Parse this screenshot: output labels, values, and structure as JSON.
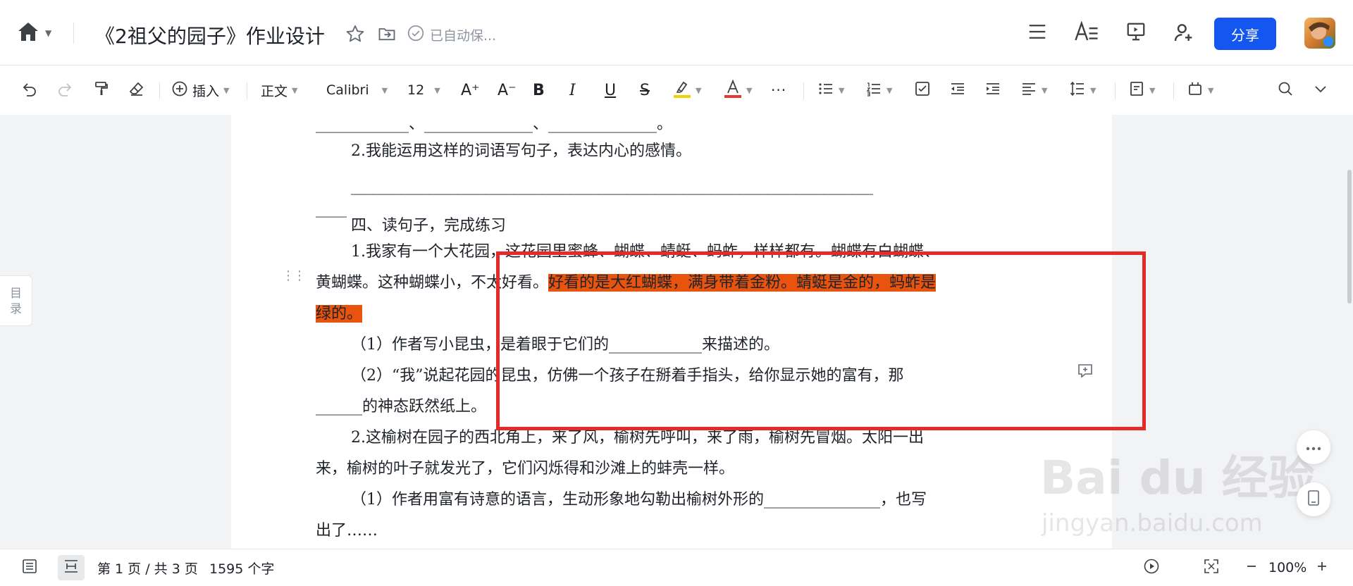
{
  "header": {
    "title": "《2祖父的园子》作业设计",
    "autosave_status": "已自动保...",
    "share_label": "分享"
  },
  "toolbar": {
    "insert_label": "插入",
    "style_label": "正文",
    "font_label": "Calibri",
    "size_label": "12",
    "more_label": "···",
    "highlight_color": "#f5d000",
    "font_color": "#e53935"
  },
  "sidebar": {
    "toc_label_1": "目",
    "toc_label_2": "录"
  },
  "document": {
    "lines": [
      "____________、______________、______________。",
      "2.我能运用这样的词语写句子，表达内心的感情。",
      "__________________________________________________________________________",
      "____",
      "四、读句子，完成练习",
      "1.我家有一个大花园，这花园里蜜蜂、蝴蝶、蜻蜓、蚂蚱，样样都有。蝴蝶有白蝴蝶、",
      "黄蝴蝶。这种蝴蝶小，不太好看。",
      "好看的是大红蝴蝶，满身带着金粉。蜻蜓是金的，蚂蚱是",
      "绿的。",
      "（1）作者写小昆虫，是着眼于它们的____________来描述的。",
      "（2）“我”说起花园的昆虫，仿佛一个孩子在掰着手指头，给你显示她的富有，那",
      "______的神态跃然纸上。",
      "2.这榆树在园子的西北角上，来了风，榆树先呼叫，来了雨，榆树先冒烟。太阳一出",
      "来，榆树的叶子就发光了，它们闪烁得和沙滩上的蚌壳一样。",
      "（1）作者用富有诗意的语言，生动形象地勾勒出榆树外形的_______________，也写",
      "出了……"
    ],
    "highlight_color": "#e8540e",
    "annotation_color": "#e52a2a"
  },
  "watermark": {
    "line1": "Bai du 经验",
    "line2": "jingyan.baidu.com"
  },
  "status": {
    "page_info": "第 1 页 / 共 3 页",
    "word_count": "1595 个字",
    "zoom": "100%"
  },
  "icons": [
    "home-icon",
    "star-icon",
    "move-icon",
    "cloud-check-icon",
    "menu-icon",
    "text-format-icon",
    "present-icon",
    "add-user-icon",
    "undo-icon",
    "redo-icon",
    "format-painter-icon",
    "eraser-icon",
    "plus-circle-icon",
    "bold-icon",
    "italic-icon",
    "underline-icon",
    "strikethrough-icon",
    "highlight-icon",
    "font-color-icon",
    "bullet-list-icon",
    "numbered-list-icon",
    "checkbox-icon",
    "outdent-icon",
    "indent-icon",
    "align-icon",
    "line-spacing-icon",
    "page-setup-icon",
    "plugin-icon",
    "search-icon",
    "chevron-down-icon",
    "comment-add-icon",
    "more-icon",
    "mobile-icon",
    "outline-icon",
    "page-view-icon",
    "play-icon",
    "fullscreen-icon",
    "zoom-out-icon",
    "zoom-in-icon"
  ]
}
